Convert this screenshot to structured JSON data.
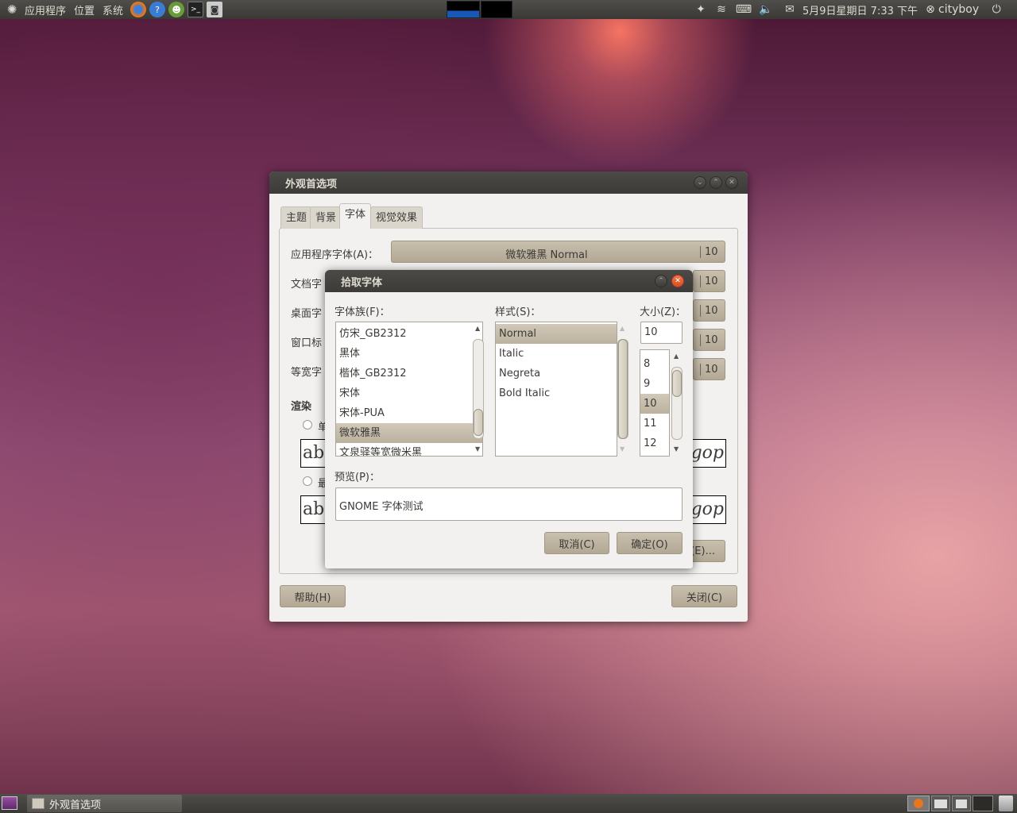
{
  "top_panel": {
    "menus": [
      "应用程序",
      "位置",
      "系统"
    ],
    "clock": "5月9日星期日 7:33 下午",
    "user": "cityboy",
    "launchers": [
      "firefox-icon",
      "help-icon",
      "games-icon",
      "terminal-icon",
      "screenshot-icon"
    ]
  },
  "appearance_window": {
    "title": "外观首选项",
    "tabs": [
      "主题",
      "背景",
      "字体",
      "视觉效果"
    ],
    "active_tab": "字体",
    "app_font_label": "应用程序字体(A)：",
    "app_font_value": "微软雅黑 Normal",
    "doc_font_label": "文档字",
    "desktop_font_label": "桌面字",
    "window_title_font_label": "窗口标",
    "fixed_font_label": "等宽字",
    "font_size": "10",
    "rendering_heading": "渲染",
    "radio1_label": "单",
    "radio2_label": "最",
    "sample_left": "ab",
    "sample_right": "gop",
    "details_button": "(E)...",
    "help_button": "帮助(H)",
    "close_button": "关闭(C)"
  },
  "font_picker": {
    "title": "拾取字体",
    "family_label": "字体族(F)：",
    "style_label": "样式(S)：",
    "size_label": "大小(Z)：",
    "families": [
      "仿宋_GB2312",
      "黑体",
      "楷体_GB2312",
      "宋体",
      "宋体-PUA",
      "微软雅黑",
      "文泉驿等宽微米黑"
    ],
    "selected_family": "微软雅黑",
    "styles": [
      "Normal",
      "Italic",
      "Negreta",
      "Bold Italic"
    ],
    "selected_style": "Normal",
    "size_value": "10",
    "sizes": [
      "8",
      "9",
      "10",
      "11",
      "12"
    ],
    "selected_size": "10",
    "preview_label": "预览(P)：",
    "preview_text": "GNOME 字体测试",
    "cancel_button": "取消(C)",
    "ok_button": "确定(O)"
  },
  "bottom_panel": {
    "task": "外观首选项"
  }
}
